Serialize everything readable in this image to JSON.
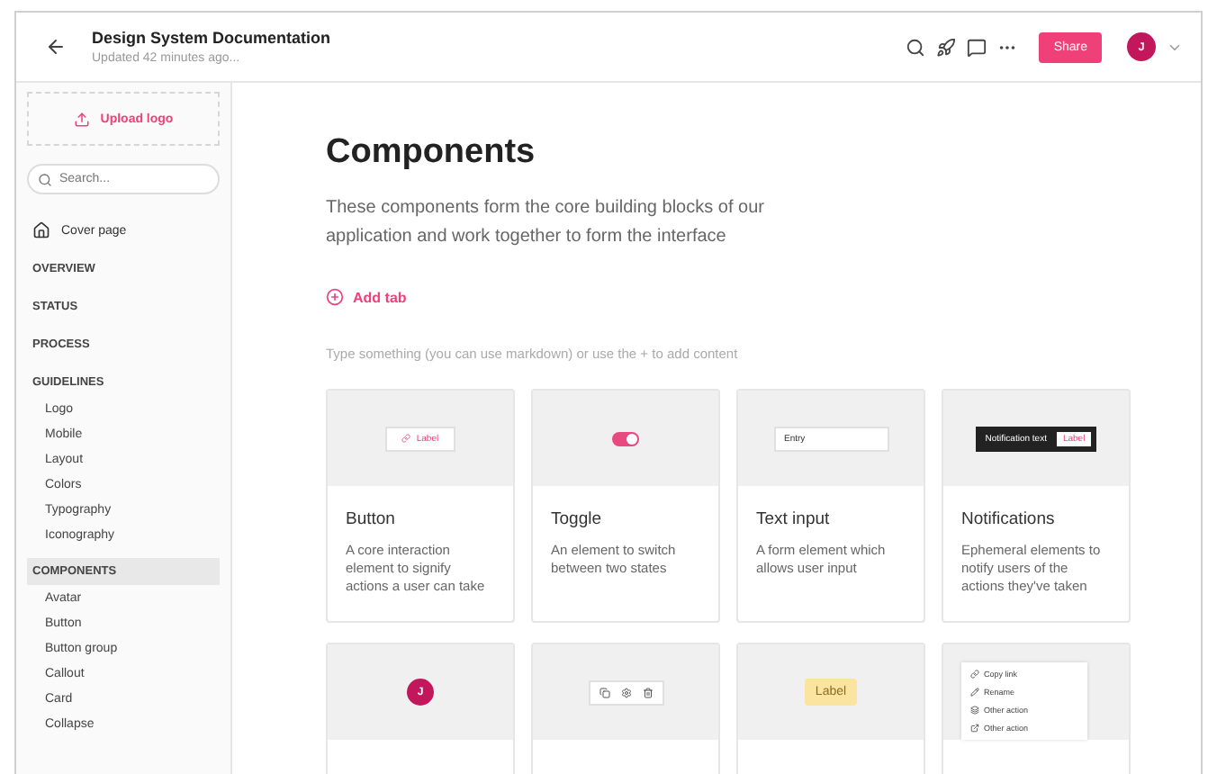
{
  "header": {
    "title": "Design System Documentation",
    "subtitle": "Updated 42 minutes ago...",
    "share": "Share",
    "avatar": "J"
  },
  "sidebar": {
    "upload": "Upload logo",
    "search": {
      "placeholder": "Search..."
    },
    "cover": {
      "label": "Cover page",
      "selected": false
    },
    "sections": [
      {
        "label": "OVERVIEW",
        "selected": false
      },
      {
        "label": "STATUS",
        "selected": false
      },
      {
        "label": "PROCESS",
        "selected": false
      },
      {
        "label": "GUIDELINES",
        "selected": false,
        "children": [
          {
            "label": "Logo",
            "selected": false
          },
          {
            "label": "Mobile",
            "selected": false
          },
          {
            "label": "Layout",
            "selected": false
          },
          {
            "label": "Colors",
            "selected": false
          },
          {
            "label": "Typography",
            "selected": false
          },
          {
            "label": "Iconography",
            "selected": false
          }
        ]
      },
      {
        "label": "COMPONENTS",
        "selected": true,
        "children": [
          {
            "label": "Avatar",
            "selected": false
          },
          {
            "label": "Button",
            "selected": false
          },
          {
            "label": "Button group",
            "selected": false
          },
          {
            "label": "Callout",
            "selected": false
          },
          {
            "label": "Card",
            "selected": false
          },
          {
            "label": "Collapse",
            "selected": false
          }
        ]
      }
    ]
  },
  "main": {
    "title": "Components",
    "description": "These components form the core building blocks of our application and work together to form the interface",
    "add_tab": "Add tab",
    "hint": "Type something (you can use markdown) or use the + to add content",
    "cards": [
      {
        "kind": "button",
        "preview": "Label",
        "title": "Button",
        "description": "A core interaction element to signify actions a user can take"
      },
      {
        "kind": "toggle",
        "on": true,
        "title": "Toggle",
        "description": "An element to switch between two states"
      },
      {
        "kind": "input",
        "preview": "Entry",
        "title": "Text input",
        "description": "A form element which allows user input"
      },
      {
        "kind": "notification",
        "preview": "Notification text",
        "action": "Label",
        "title": "Notifications",
        "description": "Ephemeral elements to notify users of the actions they've taken"
      },
      {
        "kind": "avatar",
        "preview": "J"
      },
      {
        "kind": "buttongroup"
      },
      {
        "kind": "tag",
        "preview": "Label"
      },
      {
        "kind": "menu",
        "items": [
          "Copy link",
          "Rename",
          "Other action",
          "Other action"
        ]
      }
    ]
  }
}
